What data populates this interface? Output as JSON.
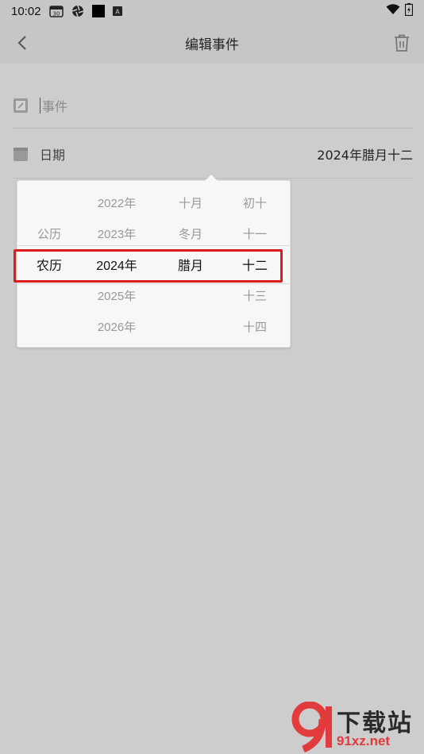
{
  "status_bar": {
    "time": "10:02",
    "calendar_day": "30",
    "badge_letter": "A",
    "icons": [
      "calendar-icon",
      "shutter-icon",
      "black-square-icon",
      "a-badge-icon",
      "wifi-icon",
      "battery-icon"
    ]
  },
  "app_bar": {
    "title": "编辑事件",
    "back_icon": "back-chevron-icon",
    "delete_icon": "trash-icon"
  },
  "form": {
    "event_placeholder": "事件",
    "date_label": "日期",
    "date_value": "2024年腊月十二"
  },
  "picker": {
    "calendar_type": {
      "items": [
        "公历",
        "农历"
      ],
      "selected": "农历"
    },
    "years": [
      "2022年",
      "2023年",
      "2024年",
      "2025年",
      "2026年"
    ],
    "months": [
      "十月",
      "冬月",
      "腊月"
    ],
    "days": [
      "初十",
      "十一",
      "十二",
      "十三",
      "十四"
    ],
    "selected": {
      "type": "农历",
      "year": "2024年",
      "month": "腊月",
      "day": "十二"
    },
    "highlight_color": "#e01a1a"
  },
  "watermark": {
    "top_text": "下载站",
    "bottom_text": "91xz.net",
    "logo_color": "#e23b3b"
  }
}
